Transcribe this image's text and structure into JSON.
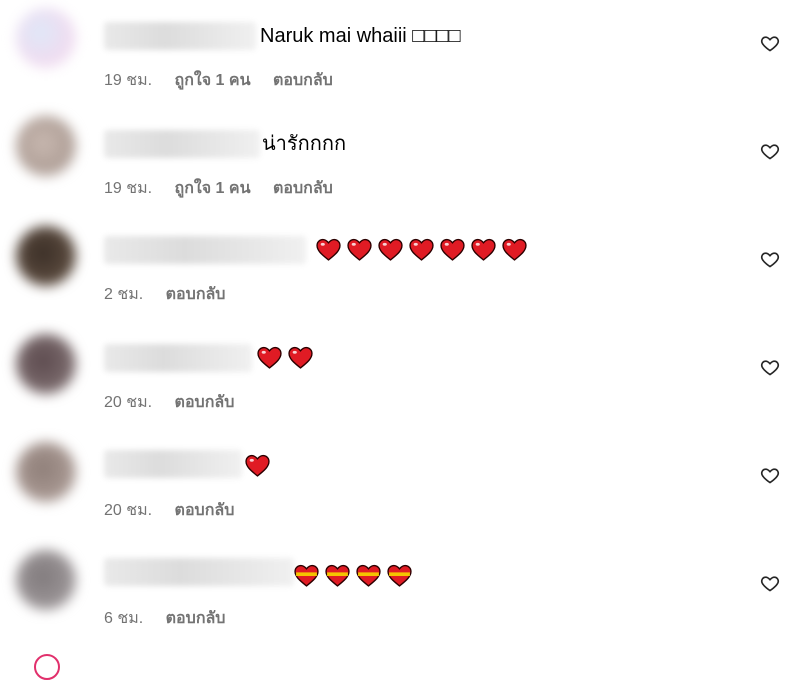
{
  "comments": [
    {
      "text": "Naruk mai whaiii □□□□",
      "time": "19 ชม.",
      "likes": "ถูกใจ 1 คน",
      "reply": "ตอบกลับ",
      "avatar_color": "#e6dcf2",
      "emoji_count": 0
    },
    {
      "text": "น่ารักกกก",
      "time": "19 ชม.",
      "likes": "ถูกใจ 1 คน",
      "reply": "ตอบกลับ",
      "avatar_color": "#b9a9a3",
      "emoji_count": 0
    },
    {
      "text": "",
      "time": "2 ชม.",
      "reply": "ตอบกลับ",
      "avatar_color": "#4a3c32",
      "emoji_count": 7,
      "emoji": "red-heart"
    },
    {
      "text": "",
      "time": "20 ชม.",
      "reply": "ตอบกลับ",
      "avatar_color": "#6c5b5e",
      "emoji_count": 2,
      "emoji": "red-heart"
    },
    {
      "text": "",
      "time": "20 ชม.",
      "reply": "ตอบกลับ",
      "avatar_color": "#9c8c86",
      "emoji_count": 1,
      "emoji": "red-heart"
    },
    {
      "text": "",
      "time": "6 ชม.",
      "reply": "ตอบกลับ",
      "avatar_color": "#8f8a8c",
      "emoji_count": 4,
      "emoji": "heart-with-ribbon"
    }
  ],
  "colors": {
    "meta_text": "#737373",
    "emoji_red": "#e01b24",
    "ribbon_gold": "#f5c400"
  },
  "icons": {
    "like": "heart-outline-icon"
  }
}
